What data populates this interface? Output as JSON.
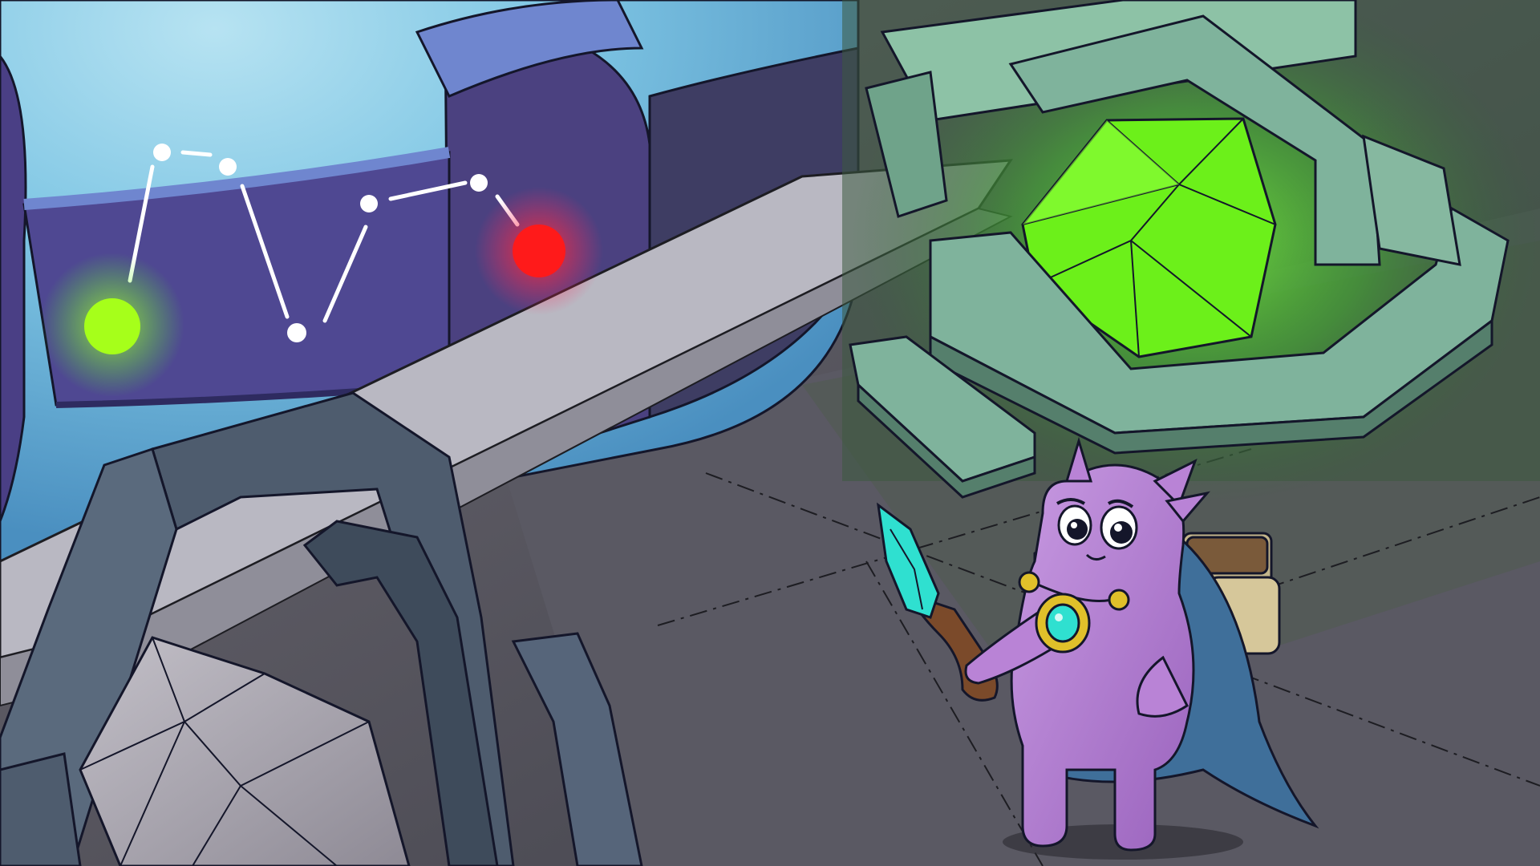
{
  "scene": {
    "colors": {
      "wall_glow": "#8fd0ea",
      "wall_deep": "#3b4a8f",
      "panel_purple": "#4b4180",
      "floor": "#5c5b66",
      "floor_light": "#8a8791",
      "green_crystal": "#6cf01a",
      "green_glow": "#4ac42a",
      "start_node": "#a6ff1a",
      "end_node": "#ff1a1a",
      "node_white": "#ffffff",
      "pedestal_gray": "#52606e",
      "shrine_teal": "#7fb39c",
      "player_body": "#b983d6",
      "cape_blue": "#3f6f9a",
      "gem_cyan": "#2fe0d0",
      "amulet_gold": "#e0c02a"
    },
    "objects": {
      "constellation": "constellation-puzzle",
      "shrine": "green-crystal-shrine",
      "pedestal": "gray-d20-pedestal",
      "player": "purple-wizard-character"
    }
  }
}
